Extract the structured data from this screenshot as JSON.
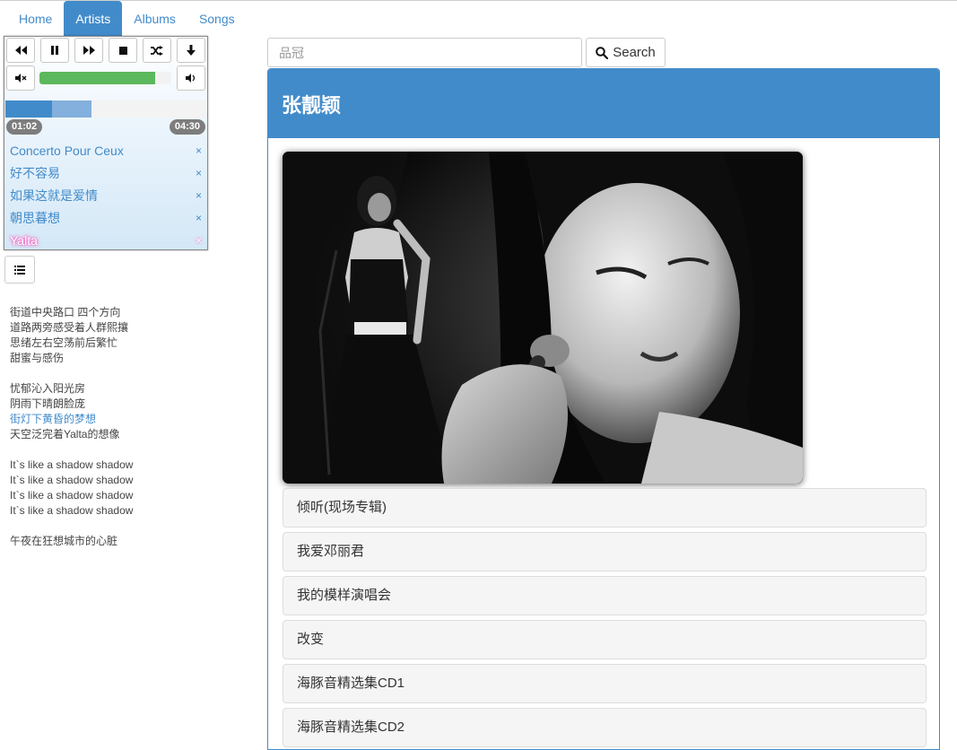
{
  "nav": {
    "items": [
      {
        "label": "Home",
        "active": false
      },
      {
        "label": "Artists",
        "active": true
      },
      {
        "label": "Albums",
        "active": false
      },
      {
        "label": "Songs",
        "active": false
      }
    ]
  },
  "player": {
    "controls": [
      "previous-icon",
      "pause-icon",
      "next-icon",
      "stop-icon",
      "shuffle-icon",
      "download-icon"
    ],
    "volume_level": 0.88,
    "progress_played": 0.23,
    "progress_buffered": 0.43,
    "current_time": "01:02",
    "duration": "04:30",
    "playlist": [
      {
        "title": "Concerto Pour Ceux",
        "current": false
      },
      {
        "title": "好不容易",
        "current": false
      },
      {
        "title": "如果这就是爱情",
        "current": false
      },
      {
        "title": "朝思暮想",
        "current": false
      },
      {
        "title": "Yalta",
        "current": true
      }
    ],
    "remove_glyph": "×"
  },
  "lyrics": [
    {
      "text": "街道中央路口 四个方向",
      "active": false
    },
    {
      "text": "道路两旁感受着人群熙攘",
      "active": false
    },
    {
      "text": "思绪左右空荡前后繁忙",
      "active": false
    },
    {
      "text": "甜蜜与感伤",
      "active": false
    },
    {
      "text": "",
      "active": false
    },
    {
      "text": "忧郁沁入阳光房",
      "active": false
    },
    {
      "text": "阴雨下晴朗脸庞",
      "active": false
    },
    {
      "text": "街灯下黄昏的梦想",
      "active": true
    },
    {
      "text": "天空泛完着Yalta的想像",
      "active": false
    },
    {
      "text": "",
      "active": false
    },
    {
      "text": "It`s like a shadow shadow",
      "active": false
    },
    {
      "text": "It`s like a shadow shadow",
      "active": false
    },
    {
      "text": "It`s like a shadow shadow",
      "active": false
    },
    {
      "text": "It`s like a shadow shadow",
      "active": false
    },
    {
      "text": "",
      "active": false
    },
    {
      "text": "午夜在狂想城市的心脏",
      "active": false
    }
  ],
  "search": {
    "placeholder": "品冠",
    "button_label": "Search"
  },
  "artist": {
    "name": "张靓颖",
    "albums": [
      "倾听(现场专辑)",
      "我爱邓丽君",
      "我的模样演唱会",
      "改变",
      "海豚音精选集CD1",
      "海豚音精选集CD2"
    ]
  },
  "colors": {
    "accent": "#428bca",
    "volume": "#5cb85c",
    "current_track_glow": "#ff3fb6"
  }
}
